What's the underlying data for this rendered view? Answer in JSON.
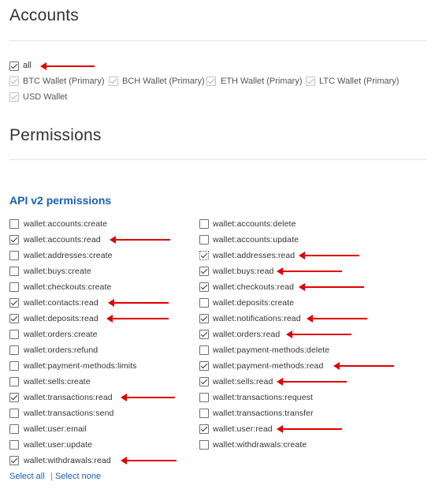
{
  "accounts": {
    "heading": "Accounts",
    "all_label": "all",
    "wallets": [
      {
        "label": "BTC Wallet (Primary)"
      },
      {
        "label": "BCH Wallet (Primary)"
      },
      {
        "label": "ETH Wallet (Primary)"
      },
      {
        "label": "LTC Wallet (Primary)"
      },
      {
        "label": "USD Wallet"
      }
    ]
  },
  "permissions": {
    "heading": "Permissions",
    "subheading": "API v2 permissions",
    "left": [
      {
        "label": "wallet:accounts:create",
        "checked": false
      },
      {
        "label": "wallet:accounts:read",
        "checked": true
      },
      {
        "label": "wallet:addresses:create",
        "checked": false
      },
      {
        "label": "wallet:buys:create",
        "checked": false
      },
      {
        "label": "wallet:checkouts:create",
        "checked": false
      },
      {
        "label": "wallet:contacts:read",
        "checked": true
      },
      {
        "label": "wallet:deposits:read",
        "checked": true
      },
      {
        "label": "wallet:orders:create",
        "checked": false
      },
      {
        "label": "wallet:orders:refund",
        "checked": false
      },
      {
        "label": "wallet:payment-methods:limits",
        "checked": false
      },
      {
        "label": "wallet:sells:create",
        "checked": false
      },
      {
        "label": "wallet:transactions:read",
        "checked": true
      },
      {
        "label": "wallet:transactions:send",
        "checked": false
      },
      {
        "label": "wallet:user:email",
        "checked": false
      },
      {
        "label": "wallet:user:update",
        "checked": false
      },
      {
        "label": "wallet:withdrawals:read",
        "checked": true
      }
    ],
    "right": [
      {
        "label": "wallet:accounts:delete",
        "checked": false
      },
      {
        "label": "wallet:accounts:update",
        "checked": false
      },
      {
        "label": "wallet:addresses:read",
        "checked": true
      },
      {
        "label": "wallet:buys:read",
        "checked": true
      },
      {
        "label": "wallet:checkouts:read",
        "checked": true
      },
      {
        "label": "wallet:deposits:create",
        "checked": false
      },
      {
        "label": "wallet:notifications:read",
        "checked": true
      },
      {
        "label": "wallet:orders:read",
        "checked": true
      },
      {
        "label": "wallet:payment-methods:delete",
        "checked": false
      },
      {
        "label": "wallet:payment-methods:read",
        "checked": true
      },
      {
        "label": "wallet:sells:read",
        "checked": true
      },
      {
        "label": "wallet:transactions:request",
        "checked": false
      },
      {
        "label": "wallet:transactions:transfer",
        "checked": false
      },
      {
        "label": "wallet:user:read",
        "checked": true
      },
      {
        "label": "wallet:withdrawals:create",
        "checked": false
      }
    ],
    "select_all_label": "Select all",
    "separator": "|",
    "select_none_label": "Select none"
  },
  "colors": {
    "accent": "#1a5fb4",
    "annotation_arrow": "#e00000"
  }
}
